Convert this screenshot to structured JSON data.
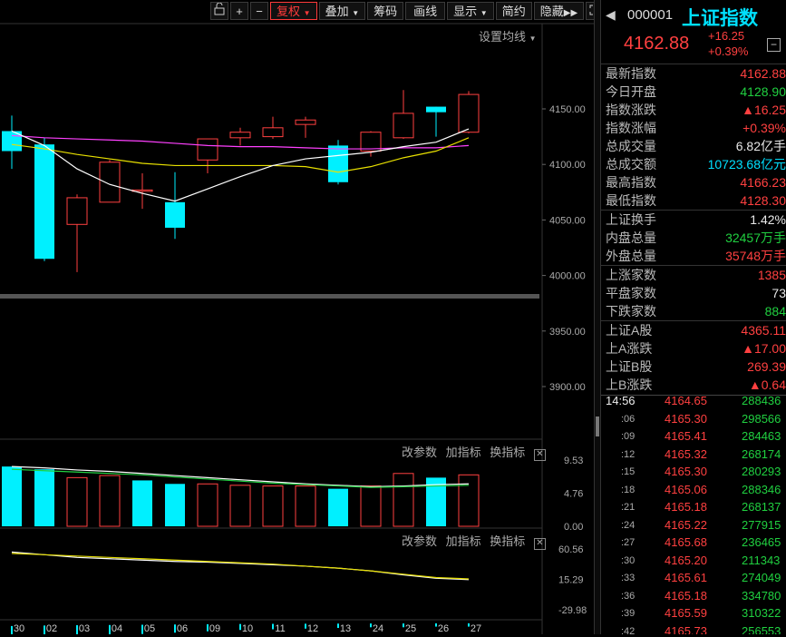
{
  "toolbar": {
    "lock_icon": "lock-icon",
    "zoom_in": "+",
    "zoom_out": "−",
    "fuquan": "复权",
    "diejia": "叠加",
    "chouma": "筹码",
    "huaxian": "画线",
    "xianshi": "显示",
    "jianyue": "简约",
    "yincang": "隐藏",
    "fullscreen_icon": "fullscreen-icon"
  },
  "chart_controls": {
    "ma_settings": "设置均线",
    "vol_params": "改参数",
    "vol_add": "加指标",
    "vol_switch": "换指标",
    "ind_params": "改参数",
    "ind_add": "加指标",
    "ind_switch": "换指标"
  },
  "colors": {
    "up": "#ff4040",
    "down": "#00f0ff",
    "ma5": "#ffffff",
    "ma10": "#e8e000",
    "ma20": "#ff40ff",
    "bg": "#000000"
  },
  "chart_data": [
    {
      "type": "candlestick",
      "dates": [
        "30",
        "02",
        "03",
        "04",
        "05",
        "06",
        "09",
        "10",
        "11",
        "12",
        "13",
        "24",
        "25",
        "26",
        "27"
      ],
      "ohlc": [
        [
          4130,
          4112,
          4144,
          4096
        ],
        [
          4118,
          4015,
          4124,
          4013
        ],
        [
          4046,
          4070,
          4073,
          4003
        ],
        [
          4066,
          4102,
          4104,
          4066
        ],
        [
          4077,
          4077,
          4092,
          4060
        ],
        [
          4066,
          4043,
          4093,
          4033
        ],
        [
          4104,
          4123,
          4123,
          4092
        ],
        [
          4124,
          4129,
          4133,
          4117
        ],
        [
          4125,
          4133,
          4143,
          4123
        ],
        [
          4136,
          4140,
          4143,
          4124
        ],
        [
          4117,
          4084,
          4122,
          4082
        ],
        [
          4112,
          4129,
          4130,
          4107
        ],
        [
          4124,
          4146,
          4167,
          4123
        ],
        [
          4152,
          4147,
          4152,
          4125
        ],
        [
          4129,
          4163,
          4166,
          4128
        ]
      ],
      "ma_white": [
        4130,
        4117,
        4096,
        4082,
        4074,
        4067,
        4078,
        4089,
        4099,
        4105,
        4108,
        4111,
        4116,
        4120,
        4132
      ],
      "ma_yellow": [
        4118,
        4114,
        4109,
        4105,
        4101,
        4099,
        4099,
        4099,
        4099,
        4098,
        4093,
        4098,
        4106,
        4112,
        4124
      ],
      "ma_magenta": [
        4126,
        4124,
        4123,
        4122,
        4121,
        4119,
        4117,
        4116,
        4116,
        4115,
        4114,
        4114,
        4115,
        4115,
        4117
      ],
      "y_ticks": [
        "4150.00",
        "4100.00",
        "4050.00",
        "4000.00",
        "3950.00",
        "3900.00"
      ],
      "ylim": [
        3885,
        4192
      ]
    },
    {
      "type": "bar",
      "name": "volume",
      "values": [
        8.6,
        8.2,
        7.0,
        7.3,
        6.6,
        6.1,
        6.1,
        5.9,
        5.8,
        5.8,
        5.4,
        5.8,
        7.6,
        7.0,
        7.4
      ],
      "up": [
        false,
        false,
        true,
        true,
        false,
        false,
        true,
        true,
        true,
        true,
        false,
        true,
        true,
        false,
        true
      ],
      "y_ticks": [
        "9.53",
        "4.76",
        "0.00"
      ],
      "ylim": [
        0,
        9.53
      ]
    },
    {
      "type": "line",
      "name": "indicator",
      "white": [
        56,
        52,
        48,
        46,
        44,
        42,
        41,
        39,
        37,
        35,
        32,
        28,
        22,
        17,
        15
      ],
      "yellow": [
        54,
        52,
        50,
        48,
        46,
        44,
        42,
        40,
        38,
        35,
        32,
        28,
        23,
        18,
        16
      ],
      "bars": [
        -22,
        -18,
        -15,
        -14,
        -12,
        -10,
        -8,
        -6,
        -5,
        -4,
        -3,
        -2,
        -2,
        -1,
        -1
      ],
      "y_ticks": [
        "60.56",
        "15.29",
        "-29.98"
      ],
      "ylim": [
        -29.98,
        60.56
      ]
    }
  ],
  "panel": {
    "code": "000001",
    "name": "上证指数",
    "price": "4162.88",
    "change": "+16.25",
    "change_pct": "+0.39%",
    "menu_icon": "minus-box-icon",
    "back_icon": "triangle-left-icon",
    "stats": [
      {
        "label": "最新指数",
        "value": "4162.88",
        "color": "red"
      },
      {
        "label": "今日开盘",
        "value": "4128.90",
        "color": "green"
      },
      {
        "label": "指数涨跌",
        "value": "▲16.25",
        "color": "red"
      },
      {
        "label": "指数涨幅",
        "value": "+0.39%",
        "color": "red"
      },
      {
        "label": "总成交量",
        "value": "6.82亿手",
        "color": "white"
      },
      {
        "label": "总成交额",
        "value": "10723.68亿元",
        "color": "cyan"
      },
      {
        "label": "最高指数",
        "value": "4166.23",
        "color": "red"
      },
      {
        "label": "最低指数",
        "value": "4128.30",
        "color": "red"
      },
      {
        "label": "上证换手",
        "value": "1.42%",
        "color": "white"
      },
      {
        "label": "内盘总量",
        "value": "32457万手",
        "color": "green"
      },
      {
        "label": "外盘总量",
        "value": "35748万手",
        "color": "red"
      },
      {
        "label": "上涨家数",
        "value": "1385",
        "color": "red"
      },
      {
        "label": "平盘家数",
        "value": "73",
        "color": "white"
      },
      {
        "label": "下跌家数",
        "value": "884",
        "color": "green"
      },
      {
        "label": "上证A股",
        "value": "4365.11",
        "color": "red"
      },
      {
        "label": "上A涨跌",
        "value": "▲17.00",
        "color": "red"
      },
      {
        "label": "上证B股",
        "value": "269.39",
        "color": "red"
      },
      {
        "label": "上B涨跌",
        "value": "▲0.64",
        "color": "red"
      }
    ],
    "ticks": [
      {
        "time": "14:56",
        "price": "4164.65",
        "vol": "288436"
      },
      {
        "time": ":06",
        "price": "4165.30",
        "vol": "298566"
      },
      {
        "time": ":09",
        "price": "4165.41",
        "vol": "284463"
      },
      {
        "time": ":12",
        "price": "4165.32",
        "vol": "268174"
      },
      {
        "time": ":15",
        "price": "4165.30",
        "vol": "280293"
      },
      {
        "time": ":18",
        "price": "4165.06",
        "vol": "288346"
      },
      {
        "time": ":21",
        "price": "4165.18",
        "vol": "268137"
      },
      {
        "time": ":24",
        "price": "4165.22",
        "vol": "277915"
      },
      {
        "time": ":27",
        "price": "4165.68",
        "vol": "236465"
      },
      {
        "time": ":30",
        "price": "4165.20",
        "vol": "211343"
      },
      {
        "time": ":33",
        "price": "4165.61",
        "vol": "274049"
      },
      {
        "time": ":36",
        "price": "4165.18",
        "vol": "334780"
      },
      {
        "time": ":39",
        "price": "4165.59",
        "vol": "310322"
      },
      {
        "time": ":42",
        "price": "4165.73",
        "vol": "256553"
      }
    ]
  }
}
